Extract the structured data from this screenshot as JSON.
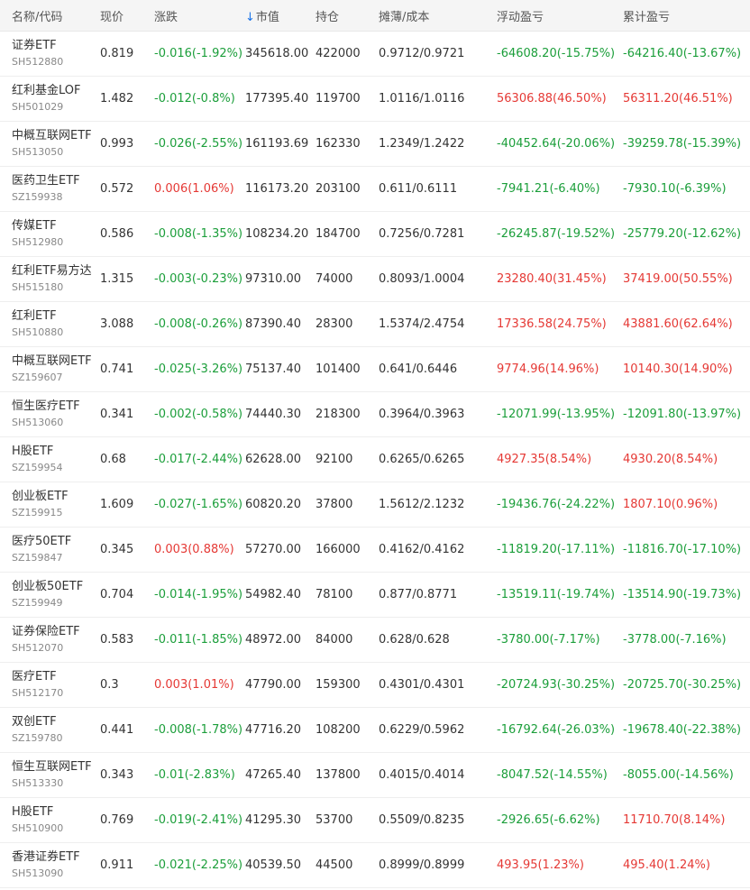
{
  "header": {
    "name_code": "名称/代码",
    "price": "现价",
    "change": "涨跌",
    "sort_arrow": "↓",
    "market_value": "市值",
    "holdings": "持仓",
    "cost": "摊薄/成本",
    "floating_pl": "浮动盈亏",
    "cumulative_pl": "累计盈亏"
  },
  "colors": {
    "up": "#e53935",
    "down": "#1b9e3a",
    "sort_icon": "#1a73e8"
  },
  "icons": {
    "sort": "arrow-down-icon"
  },
  "rows": [
    {
      "name": "证券ETF",
      "code": "SH512880",
      "price": "0.819",
      "change": "-0.016(-1.92%)",
      "change_dir": "down",
      "mv": "345618.00",
      "qty": "422000",
      "cost": "0.9712/0.9721",
      "float_pl": "-64608.20(-15.75%)",
      "float_dir": "down",
      "total_pl": "-64216.40(-13.67%)",
      "total_dir": "down"
    },
    {
      "name": "红利基金LOF",
      "code": "SH501029",
      "price": "1.482",
      "change": "-0.012(-0.8%)",
      "change_dir": "down",
      "mv": "177395.40",
      "qty": "119700",
      "cost": "1.0116/1.0116",
      "float_pl": "56306.88(46.50%)",
      "float_dir": "up",
      "total_pl": "56311.20(46.51%)",
      "total_dir": "up"
    },
    {
      "name": "中概互联网ETF",
      "code": "SH513050",
      "price": "0.993",
      "change": "-0.026(-2.55%)",
      "change_dir": "down",
      "mv": "161193.69",
      "qty": "162330",
      "cost": "1.2349/1.2422",
      "float_pl": "-40452.64(-20.06%)",
      "float_dir": "down",
      "total_pl": "-39259.78(-15.39%)",
      "total_dir": "down"
    },
    {
      "name": "医药卫生ETF",
      "code": "SZ159938",
      "price": "0.572",
      "change": "0.006(1.06%)",
      "change_dir": "up",
      "mv": "116173.20",
      "qty": "203100",
      "cost": "0.611/0.6111",
      "float_pl": "-7941.21(-6.40%)",
      "float_dir": "down",
      "total_pl": "-7930.10(-6.39%)",
      "total_dir": "down"
    },
    {
      "name": "传媒ETF",
      "code": "SH512980",
      "price": "0.586",
      "change": "-0.008(-1.35%)",
      "change_dir": "down",
      "mv": "108234.20",
      "qty": "184700",
      "cost": "0.7256/0.7281",
      "float_pl": "-26245.87(-19.52%)",
      "float_dir": "down",
      "total_pl": "-25779.20(-12.62%)",
      "total_dir": "down"
    },
    {
      "name": "红利ETF易方达",
      "code": "SH515180",
      "price": "1.315",
      "change": "-0.003(-0.23%)",
      "change_dir": "down",
      "mv": "97310.00",
      "qty": "74000",
      "cost": "0.8093/1.0004",
      "float_pl": "23280.40(31.45%)",
      "float_dir": "up",
      "total_pl": "37419.00(50.55%)",
      "total_dir": "up"
    },
    {
      "name": "红利ETF",
      "code": "SH510880",
      "price": "3.088",
      "change": "-0.008(-0.26%)",
      "change_dir": "down",
      "mv": "87390.40",
      "qty": "28300",
      "cost": "1.5374/2.4754",
      "float_pl": "17336.58(24.75%)",
      "float_dir": "up",
      "total_pl": "43881.60(62.64%)",
      "total_dir": "up"
    },
    {
      "name": "中概互联网ETF",
      "code": "SZ159607",
      "price": "0.741",
      "change": "-0.025(-3.26%)",
      "change_dir": "down",
      "mv": "75137.40",
      "qty": "101400",
      "cost": "0.641/0.6446",
      "float_pl": "9774.96(14.96%)",
      "float_dir": "up",
      "total_pl": "10140.30(14.90%)",
      "total_dir": "up"
    },
    {
      "name": "恒生医疗ETF",
      "code": "SH513060",
      "price": "0.341",
      "change": "-0.002(-0.58%)",
      "change_dir": "down",
      "mv": "74440.30",
      "qty": "218300",
      "cost": "0.3964/0.3963",
      "float_pl": "-12071.99(-13.95%)",
      "float_dir": "down",
      "total_pl": "-12091.80(-13.97%)",
      "total_dir": "down"
    },
    {
      "name": "H股ETF",
      "code": "SZ159954",
      "price": "0.68",
      "change": "-0.017(-2.44%)",
      "change_dir": "down",
      "mv": "62628.00",
      "qty": "92100",
      "cost": "0.6265/0.6265",
      "float_pl": "4927.35(8.54%)",
      "float_dir": "up",
      "total_pl": "4930.20(8.54%)",
      "total_dir": "up"
    },
    {
      "name": "创业板ETF",
      "code": "SZ159915",
      "price": "1.609",
      "change": "-0.027(-1.65%)",
      "change_dir": "down",
      "mv": "60820.20",
      "qty": "37800",
      "cost": "1.5612/2.1232",
      "float_pl": "-19436.76(-24.22%)",
      "float_dir": "down",
      "total_pl": "1807.10(0.96%)",
      "total_dir": "up"
    },
    {
      "name": "医疗50ETF",
      "code": "SZ159847",
      "price": "0.345",
      "change": "0.003(0.88%)",
      "change_dir": "up",
      "mv": "57270.00",
      "qty": "166000",
      "cost": "0.4162/0.4162",
      "float_pl": "-11819.20(-17.11%)",
      "float_dir": "down",
      "total_pl": "-11816.70(-17.10%)",
      "total_dir": "down"
    },
    {
      "name": "创业板50ETF",
      "code": "SZ159949",
      "price": "0.704",
      "change": "-0.014(-1.95%)",
      "change_dir": "down",
      "mv": "54982.40",
      "qty": "78100",
      "cost": "0.877/0.8771",
      "float_pl": "-13519.11(-19.74%)",
      "float_dir": "down",
      "total_pl": "-13514.90(-19.73%)",
      "total_dir": "down"
    },
    {
      "name": "证券保险ETF",
      "code": "SH512070",
      "price": "0.583",
      "change": "-0.011(-1.85%)",
      "change_dir": "down",
      "mv": "48972.00",
      "qty": "84000",
      "cost": "0.628/0.628",
      "float_pl": "-3780.00(-7.17%)",
      "float_dir": "down",
      "total_pl": "-3778.00(-7.16%)",
      "total_dir": "down"
    },
    {
      "name": "医疗ETF",
      "code": "SH512170",
      "price": "0.3",
      "change": "0.003(1.01%)",
      "change_dir": "up",
      "mv": "47790.00",
      "qty": "159300",
      "cost": "0.4301/0.4301",
      "float_pl": "-20724.93(-30.25%)",
      "float_dir": "down",
      "total_pl": "-20725.70(-30.25%)",
      "total_dir": "down"
    },
    {
      "name": "双创ETF",
      "code": "SZ159780",
      "price": "0.441",
      "change": "-0.008(-1.78%)",
      "change_dir": "down",
      "mv": "47716.20",
      "qty": "108200",
      "cost": "0.6229/0.5962",
      "float_pl": "-16792.64(-26.03%)",
      "float_dir": "down",
      "total_pl": "-19678.40(-22.38%)",
      "total_dir": "down"
    },
    {
      "name": "恒生互联网ETF",
      "code": "SH513330",
      "price": "0.343",
      "change": "-0.01(-2.83%)",
      "change_dir": "down",
      "mv": "47265.40",
      "qty": "137800",
      "cost": "0.4015/0.4014",
      "float_pl": "-8047.52(-14.55%)",
      "float_dir": "down",
      "total_pl": "-8055.00(-14.56%)",
      "total_dir": "down"
    },
    {
      "name": "H股ETF",
      "code": "SH510900",
      "price": "0.769",
      "change": "-0.019(-2.41%)",
      "change_dir": "down",
      "mv": "41295.30",
      "qty": "53700",
      "cost": "0.5509/0.8235",
      "float_pl": "-2926.65(-6.62%)",
      "float_dir": "down",
      "total_pl": "11710.70(8.14%)",
      "total_dir": "up"
    },
    {
      "name": "香港证券ETF",
      "code": "SH513090",
      "price": "0.911",
      "change": "-0.021(-2.25%)",
      "change_dir": "down",
      "mv": "40539.50",
      "qty": "44500",
      "cost": "0.8999/0.8999",
      "float_pl": "493.95(1.23%)",
      "float_dir": "up",
      "total_pl": "495.40(1.24%)",
      "total_dir": "up"
    }
  ]
}
